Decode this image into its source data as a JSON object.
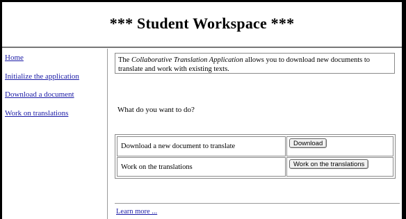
{
  "header": {
    "title": "*** Student Workspace ***"
  },
  "sidebar": {
    "items": [
      {
        "label": "Home"
      },
      {
        "label": "Initialize the application"
      },
      {
        "label": "Download a document"
      },
      {
        "label": "Work on translations"
      }
    ]
  },
  "main": {
    "intro_prefix": "The ",
    "intro_app_name": "Collaborative Translation Application",
    "intro_suffix": " allows you to download new documents to translate and work with existing texts.",
    "question": "What do you want to do?",
    "actions": [
      {
        "label": "Download a new document to translate",
        "button": "Download"
      },
      {
        "label": "Work on the translations",
        "button": "Work on the translations"
      }
    ],
    "learn_more": "Learn more ..."
  }
}
